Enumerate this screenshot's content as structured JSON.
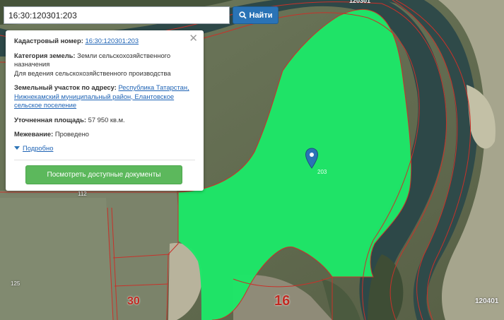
{
  "search": {
    "value": "16:30:120301:203",
    "button_label": "Найти"
  },
  "popup": {
    "cadastral_label": "Кадастровый номер:",
    "cadastral_value": "16:30:120301:203",
    "category_label": "Категория земель:",
    "category_value": "Земли сельскохозяйственного назначения",
    "usage_value": "Для ведения сельскохозяйственного производства",
    "address_label": "Земельный участок по адресу:",
    "address_value": "Республика Татарстан, Нижнекамский муниципальный район, Елантовское сельское поселение",
    "area_label": "Уточненная площадь:",
    "area_value": "57 950 кв.м.",
    "survey_label": "Межевание:",
    "survey_value": "Проведено",
    "details_label": "Подробно",
    "docs_button_label": "Посмотреть доступные документы",
    "close_icon": "close-icon"
  },
  "map_labels": {
    "parcel_top": "120301",
    "parcel_right_bottom": "120401",
    "marker_label": "203",
    "n112": "112",
    "n125": "125",
    "n30": "30",
    "n16": "16"
  },
  "colors": {
    "parcel_fill": "#1ee668",
    "boundary": "#c8322a",
    "button_primary": "#2a73b6",
    "button_success": "#5cb85c",
    "marker": "#2a73b6"
  }
}
